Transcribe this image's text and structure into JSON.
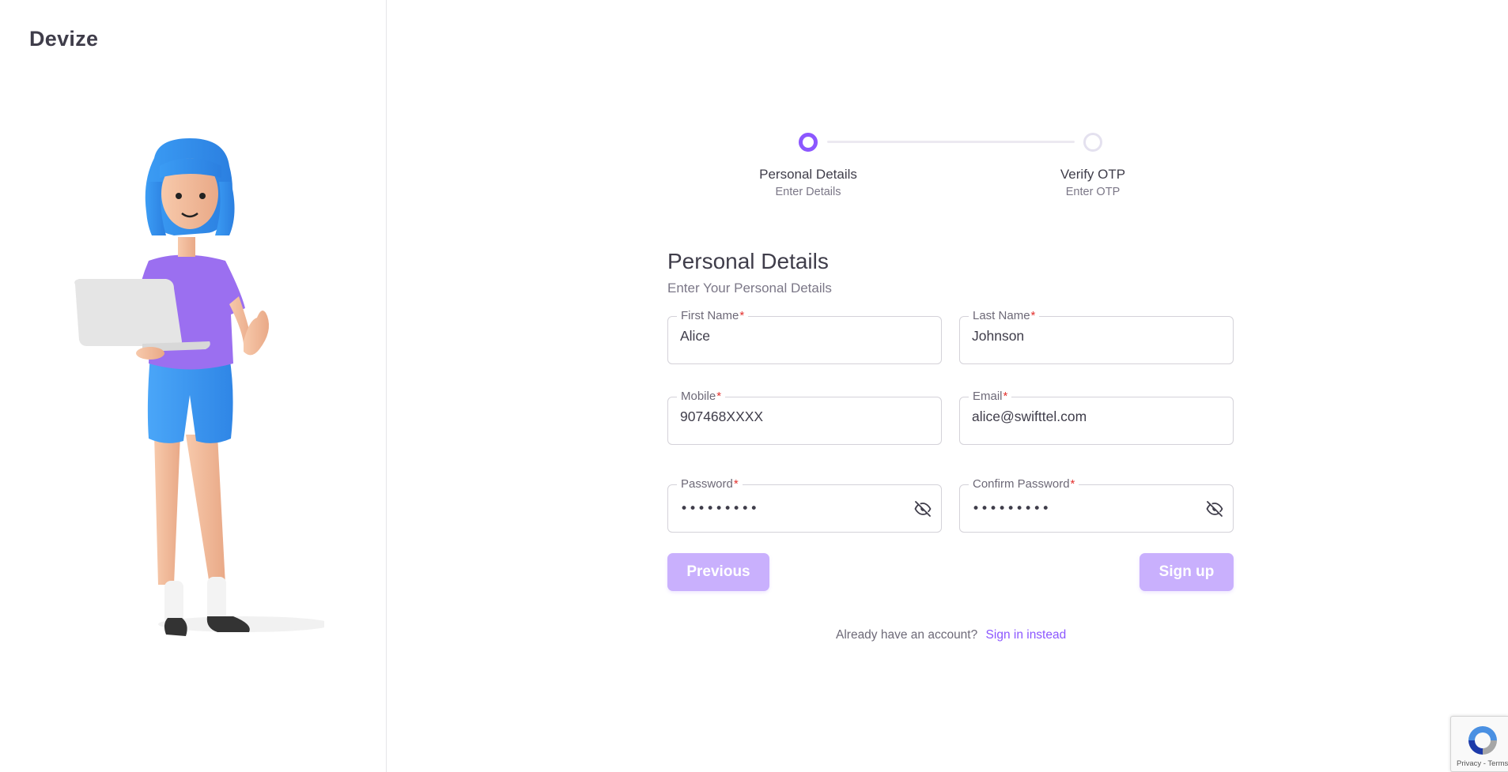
{
  "brand": {
    "name": "Devize"
  },
  "stepper": {
    "steps": [
      {
        "title": "Personal Details",
        "subtitle": "Enter Details",
        "state": "active"
      },
      {
        "title": "Verify OTP",
        "subtitle": "Enter OTP",
        "state": "inactive"
      }
    ]
  },
  "form": {
    "title": "Personal Details",
    "subtitle": "Enter Your Personal Details",
    "required_marker": "*",
    "fields": {
      "first_name": {
        "label": "First Name",
        "value": "Alice"
      },
      "last_name": {
        "label": "Last Name",
        "value": "Johnson"
      },
      "mobile": {
        "label": "Mobile",
        "value": "907468XXXX"
      },
      "email": {
        "label": "Email",
        "value": "alice@swifttel.com"
      },
      "password": {
        "label": "Password",
        "masked_value": "•••••••••",
        "toggle_icon": "eye-off-icon"
      },
      "confirm_password": {
        "label": "Confirm Password",
        "masked_value": "•••••••••",
        "toggle_icon": "eye-off-icon"
      }
    },
    "buttons": {
      "previous": "Previous",
      "submit": "Sign up"
    }
  },
  "footer": {
    "prompt": "Already have an account?",
    "link": "Sign in instead"
  },
  "recaptcha": {
    "links": "Privacy - Terms"
  },
  "colors": {
    "primary": "#8c57ff",
    "button_disabled": "#c9b0fd",
    "required": "#e3312e",
    "text": "#3f3d4a"
  }
}
